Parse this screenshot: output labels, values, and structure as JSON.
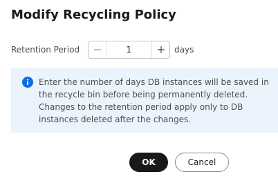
{
  "dialog": {
    "title": "Modify Recycling Policy"
  },
  "form": {
    "retention_label": "Retention Period",
    "retention_value": "1",
    "retention_unit": "days",
    "minus_symbol": "−",
    "plus_symbol": "+"
  },
  "info": {
    "icon": "info-icon",
    "text": "Enter the number of days DB instances will be saved in the recycle bin before being permanently deleted. Changes to the retention period apply only to DB instances deleted after the changes."
  },
  "actions": {
    "ok_label": "OK",
    "cancel_label": "Cancel"
  },
  "colors": {
    "primary_button": "#191919",
    "info_background": "#ebf3fd",
    "info_icon": "#0d6ce1"
  }
}
